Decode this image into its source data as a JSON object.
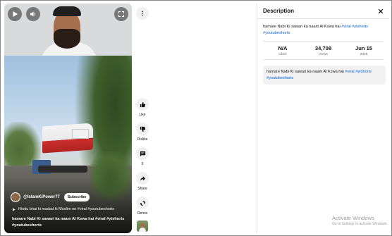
{
  "player": {
    "play_icon": "play-icon",
    "volume_icon": "volume-icon",
    "fullscreen_icon": "fullscreen-icon"
  },
  "short": {
    "channel_handle": "@IslamKiPower77",
    "subscribe_label": "Subscribe",
    "music": "Hindu bhai ki madad ki Muslim ne #viral #youtubeshorts",
    "title_text": "hamare Nabi Ki sawari ka naam Al Kswa hai",
    "title_tags": [
      "#viral",
      "#ytshorts",
      "#youtubeshorts"
    ]
  },
  "actions": {
    "like_label": "Like",
    "dislike_label": "Dislike",
    "comments_count": "0",
    "share_label": "Share",
    "remix_label": "Remix"
  },
  "description_panel": {
    "title": "Description",
    "desc_text": "hamare Nabi Ki sawari ka naam Al Kswa hai",
    "desc_tags": [
      "#viral",
      "#ytshorts",
      "#youtubeshorts"
    ],
    "stats": [
      {
        "value": "N/A",
        "label": "Likes"
      },
      {
        "value": "34,708",
        "label": "Views"
      },
      {
        "value": "Jun 15",
        "label": "2025"
      }
    ],
    "box_text": "hamare Nabi Ki sawari ka naam Al Kswa hai",
    "box_tags": [
      "#viral",
      "#ytshorts",
      "#youtubeshorts"
    ]
  },
  "watermark": {
    "title": "Activate Windows",
    "subtitle": "Go to Settings to activate Windows."
  },
  "colors": {
    "link": "#065fd4",
    "panel_box": "#f2f2f2"
  }
}
